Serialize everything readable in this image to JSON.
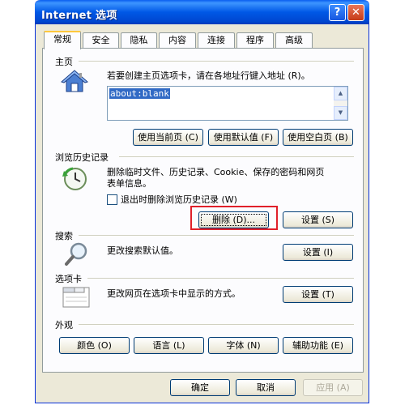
{
  "window": {
    "title": "Internet 选项",
    "help_label": "?",
    "close_label": "✕"
  },
  "tabs": [
    {
      "label": "常规",
      "active": true
    },
    {
      "label": "安全"
    },
    {
      "label": "隐私"
    },
    {
      "label": "内容"
    },
    {
      "label": "连接"
    },
    {
      "label": "程序"
    },
    {
      "label": "高级"
    }
  ],
  "homepage": {
    "section_title": "主页",
    "description": "若要创建主页选项卡，请在各地址行键入地址 (R)。",
    "address_value": "about:blank",
    "use_current": "使用当前页 (C)",
    "use_default": "使用默认值 (F)",
    "use_blank": "使用空白页 (B)"
  },
  "history": {
    "section_title": "浏览历史记录",
    "description_line1": "删除临时文件、历史记录、Cookie、保存的密码和网页",
    "description_line2": "表单信息。",
    "checkbox_label": "退出时删除浏览历史记录 (W)",
    "delete_button": "删除 (D)...",
    "settings_button": "设置 (S)"
  },
  "search": {
    "section_title": "搜索",
    "description": "更改搜索默认值。",
    "settings_button": "设置 (I)"
  },
  "tabs_section": {
    "section_title": "选项卡",
    "description": "更改网页在选项卡中显示的方式。",
    "settings_button": "设置 (T)"
  },
  "appearance": {
    "section_title": "外观",
    "colors": "颜色 (O)",
    "languages": "语言 (L)",
    "fonts": "字体 (N)",
    "accessibility": "辅助功能 (E)"
  },
  "footer": {
    "ok": "确定",
    "cancel": "取消",
    "apply": "应用 (A)"
  },
  "colors": {
    "titlebar": "#0058e6",
    "dialog_bg": "#ece9d8",
    "highlight_box": "#e0202a"
  }
}
